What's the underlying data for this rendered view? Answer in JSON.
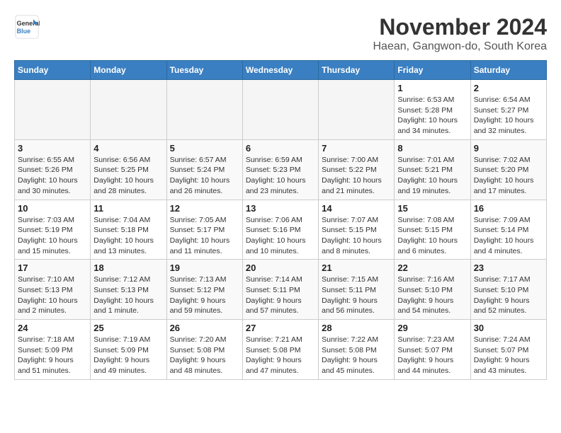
{
  "header": {
    "logo_line1": "General",
    "logo_line2": "Blue",
    "month": "November 2024",
    "location": "Haean, Gangwon-do, South Korea"
  },
  "weekdays": [
    "Sunday",
    "Monday",
    "Tuesday",
    "Wednesday",
    "Thursday",
    "Friday",
    "Saturday"
  ],
  "weeks": [
    [
      {
        "day": "",
        "info": ""
      },
      {
        "day": "",
        "info": ""
      },
      {
        "day": "",
        "info": ""
      },
      {
        "day": "",
        "info": ""
      },
      {
        "day": "",
        "info": ""
      },
      {
        "day": "1",
        "info": "Sunrise: 6:53 AM\nSunset: 5:28 PM\nDaylight: 10 hours and 34 minutes."
      },
      {
        "day": "2",
        "info": "Sunrise: 6:54 AM\nSunset: 5:27 PM\nDaylight: 10 hours and 32 minutes."
      }
    ],
    [
      {
        "day": "3",
        "info": "Sunrise: 6:55 AM\nSunset: 5:26 PM\nDaylight: 10 hours and 30 minutes."
      },
      {
        "day": "4",
        "info": "Sunrise: 6:56 AM\nSunset: 5:25 PM\nDaylight: 10 hours and 28 minutes."
      },
      {
        "day": "5",
        "info": "Sunrise: 6:57 AM\nSunset: 5:24 PM\nDaylight: 10 hours and 26 minutes."
      },
      {
        "day": "6",
        "info": "Sunrise: 6:59 AM\nSunset: 5:23 PM\nDaylight: 10 hours and 23 minutes."
      },
      {
        "day": "7",
        "info": "Sunrise: 7:00 AM\nSunset: 5:22 PM\nDaylight: 10 hours and 21 minutes."
      },
      {
        "day": "8",
        "info": "Sunrise: 7:01 AM\nSunset: 5:21 PM\nDaylight: 10 hours and 19 minutes."
      },
      {
        "day": "9",
        "info": "Sunrise: 7:02 AM\nSunset: 5:20 PM\nDaylight: 10 hours and 17 minutes."
      }
    ],
    [
      {
        "day": "10",
        "info": "Sunrise: 7:03 AM\nSunset: 5:19 PM\nDaylight: 10 hours and 15 minutes."
      },
      {
        "day": "11",
        "info": "Sunrise: 7:04 AM\nSunset: 5:18 PM\nDaylight: 10 hours and 13 minutes."
      },
      {
        "day": "12",
        "info": "Sunrise: 7:05 AM\nSunset: 5:17 PM\nDaylight: 10 hours and 11 minutes."
      },
      {
        "day": "13",
        "info": "Sunrise: 7:06 AM\nSunset: 5:16 PM\nDaylight: 10 hours and 10 minutes."
      },
      {
        "day": "14",
        "info": "Sunrise: 7:07 AM\nSunset: 5:15 PM\nDaylight: 10 hours and 8 minutes."
      },
      {
        "day": "15",
        "info": "Sunrise: 7:08 AM\nSunset: 5:15 PM\nDaylight: 10 hours and 6 minutes."
      },
      {
        "day": "16",
        "info": "Sunrise: 7:09 AM\nSunset: 5:14 PM\nDaylight: 10 hours and 4 minutes."
      }
    ],
    [
      {
        "day": "17",
        "info": "Sunrise: 7:10 AM\nSunset: 5:13 PM\nDaylight: 10 hours and 2 minutes."
      },
      {
        "day": "18",
        "info": "Sunrise: 7:12 AM\nSunset: 5:13 PM\nDaylight: 10 hours and 1 minute."
      },
      {
        "day": "19",
        "info": "Sunrise: 7:13 AM\nSunset: 5:12 PM\nDaylight: 9 hours and 59 minutes."
      },
      {
        "day": "20",
        "info": "Sunrise: 7:14 AM\nSunset: 5:11 PM\nDaylight: 9 hours and 57 minutes."
      },
      {
        "day": "21",
        "info": "Sunrise: 7:15 AM\nSunset: 5:11 PM\nDaylight: 9 hours and 56 minutes."
      },
      {
        "day": "22",
        "info": "Sunrise: 7:16 AM\nSunset: 5:10 PM\nDaylight: 9 hours and 54 minutes."
      },
      {
        "day": "23",
        "info": "Sunrise: 7:17 AM\nSunset: 5:10 PM\nDaylight: 9 hours and 52 minutes."
      }
    ],
    [
      {
        "day": "24",
        "info": "Sunrise: 7:18 AM\nSunset: 5:09 PM\nDaylight: 9 hours and 51 minutes."
      },
      {
        "day": "25",
        "info": "Sunrise: 7:19 AM\nSunset: 5:09 PM\nDaylight: 9 hours and 49 minutes."
      },
      {
        "day": "26",
        "info": "Sunrise: 7:20 AM\nSunset: 5:08 PM\nDaylight: 9 hours and 48 minutes."
      },
      {
        "day": "27",
        "info": "Sunrise: 7:21 AM\nSunset: 5:08 PM\nDaylight: 9 hours and 47 minutes."
      },
      {
        "day": "28",
        "info": "Sunrise: 7:22 AM\nSunset: 5:08 PM\nDaylight: 9 hours and 45 minutes."
      },
      {
        "day": "29",
        "info": "Sunrise: 7:23 AM\nSunset: 5:07 PM\nDaylight: 9 hours and 44 minutes."
      },
      {
        "day": "30",
        "info": "Sunrise: 7:24 AM\nSunset: 5:07 PM\nDaylight: 9 hours and 43 minutes."
      }
    ]
  ]
}
